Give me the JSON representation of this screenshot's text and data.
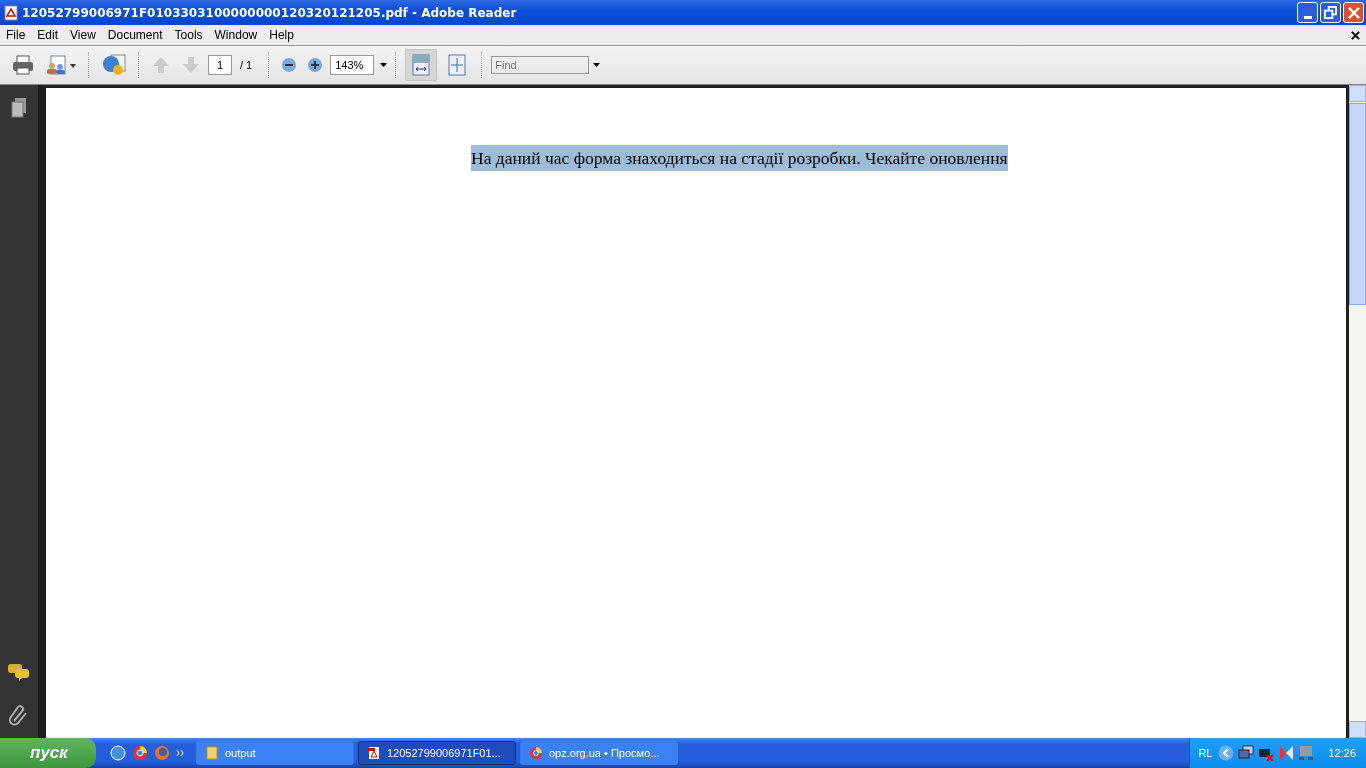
{
  "window": {
    "title": "12052799006971F0103303100000000120320121205.pdf - Adobe Reader"
  },
  "menu": [
    "File",
    "Edit",
    "View",
    "Document",
    "Tools",
    "Window",
    "Help"
  ],
  "toolbar": {
    "page_number": "1",
    "page_total": "/ 1",
    "zoom": "143%",
    "find_placeholder": "Find",
    "view_buttons": [
      {
        "kind": "fit-width",
        "selected": true
      },
      {
        "kind": "fit-page",
        "selected": false
      }
    ]
  },
  "document": {
    "text": "На даний час форма знаходиться на стадії розробки. Чекайте оновлення",
    "highlighted": true
  },
  "taskbar": {
    "start": "пуск",
    "tasks": [
      {
        "kind": "folder",
        "label": "output",
        "selected": false
      },
      {
        "kind": "pdf",
        "label": "12052799006971F01...",
        "selected": true
      },
      {
        "kind": "browser",
        "label": "opz.org.ua • Просмо...",
        "selected": false
      }
    ],
    "language": "RL",
    "clock": "12:26"
  }
}
